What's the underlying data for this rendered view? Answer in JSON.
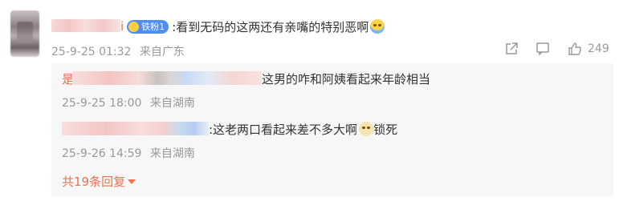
{
  "comment": {
    "username_suffix": "i",
    "badge": "铁粉1",
    "text": ":看到无码的这两还有亲嘴的特别恶啊",
    "emoji": "crying-face",
    "date": "25-9-25 01:32",
    "location": "来自广东",
    "like_count": "249"
  },
  "replies": [
    {
      "name_visible": "是",
      "text": "这男的咋和阿姨看起来年龄相当",
      "date": "25-9-25 18:00",
      "location": "来自湖南"
    },
    {
      "text": ":这老两口看起来差不多大啊",
      "emoji": "dog-face",
      "text_after": "锁死",
      "date": "25-9-26 14:59",
      "location": "来自湖南"
    }
  ],
  "more_replies": "共19条回复",
  "colors": {
    "accent": "#eb7350",
    "badge": "#4f8ef7",
    "meta": "#999999",
    "reply_bg": "#f7f7f7"
  }
}
